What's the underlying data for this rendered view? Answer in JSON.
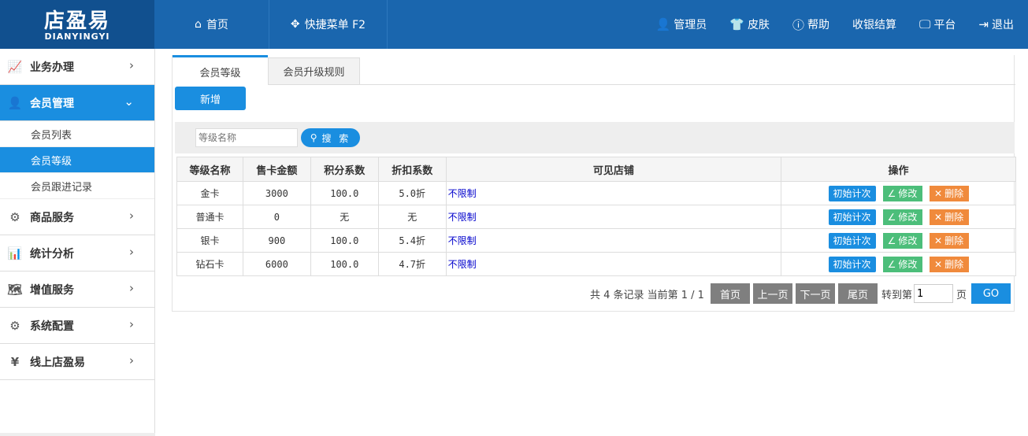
{
  "logo": {
    "cn": "店盈易",
    "en": "DIANYINGYI"
  },
  "topnav": {
    "left": [
      {
        "label": "首页",
        "icon": "home-icon"
      },
      {
        "label": "快捷菜单 F2",
        "icon": "move-icon"
      }
    ],
    "right": [
      {
        "label": "管理员",
        "icon": "user-icon"
      },
      {
        "label": "皮肤",
        "icon": "shirt-icon"
      },
      {
        "label": "帮助",
        "icon": "help-icon"
      },
      {
        "label": "收银结算",
        "icon": ""
      },
      {
        "label": "平台",
        "icon": "monitor-icon"
      },
      {
        "label": "退出",
        "icon": "logout-icon"
      }
    ]
  },
  "sidebar": {
    "items": [
      {
        "label": "业务办理",
        "icon": "chart-icon"
      },
      {
        "label": "会员管理",
        "icon": "member-icon",
        "active": true
      },
      {
        "label": "商品服务",
        "icon": "goods-icon"
      },
      {
        "label": "统计分析",
        "icon": "stats-icon"
      },
      {
        "label": "增值服务",
        "icon": "map-icon"
      },
      {
        "label": "系统配置",
        "icon": "gear-icon"
      },
      {
        "label": "线上店盈易",
        "icon": "yuan-icon"
      }
    ],
    "sub_items": [
      {
        "label": "会员列表"
      },
      {
        "label": "会员等级",
        "active": true
      },
      {
        "label": "会员跟进记录"
      }
    ]
  },
  "tabs": [
    {
      "label": "会员等级"
    },
    {
      "label": "会员升级规则"
    }
  ],
  "add_button": "新增",
  "search": {
    "placeholder": "等级名称",
    "button": "搜 索"
  },
  "table": {
    "headers": [
      "等级名称",
      "售卡金额",
      "积分系数",
      "折扣系数",
      "可见店铺",
      "操作"
    ],
    "rows": [
      {
        "name": "金卡",
        "price": "3000",
        "points": "100.0",
        "discount": "5.0折",
        "store": "不限制"
      },
      {
        "name": "普通卡",
        "price": "0",
        "points": "无",
        "discount": "无",
        "store": "不限制"
      },
      {
        "name": "银卡",
        "price": "900",
        "points": "100.0",
        "discount": "5.4折",
        "store": "不限制"
      },
      {
        "name": "钻石卡",
        "price": "6000",
        "points": "100.0",
        "discount": "4.7折",
        "store": "不限制"
      }
    ],
    "actions": {
      "init": "初始计次",
      "edit": "修改",
      "delete": "删除"
    }
  },
  "pager": {
    "info": "共 4 条记录 当前第 1 / 1",
    "first": "首页",
    "prev": "上一页",
    "next": "下一页",
    "last": "尾页",
    "goto": "转到第",
    "page_value": "1",
    "unit": "页",
    "go": "GO"
  }
}
